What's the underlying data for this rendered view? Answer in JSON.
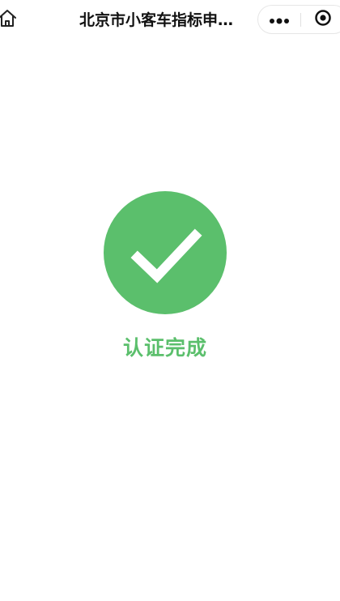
{
  "navbar": {
    "title": "北京市小客车指标申…",
    "home_icon": "home-icon",
    "more_icon": "more-dots-icon",
    "close_icon": "record-circle-icon"
  },
  "main": {
    "status_icon": "check-icon",
    "status_text": "认证完成",
    "accent_color": "#5bbf6c"
  }
}
